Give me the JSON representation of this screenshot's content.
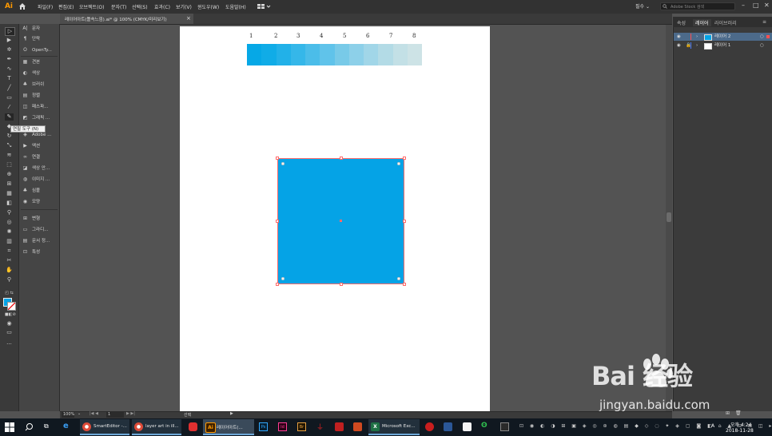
{
  "app": {
    "logo": "Ai"
  },
  "menu": {
    "items": [
      "파일(F)",
      "편집(E)",
      "오브젝트(O)",
      "문자(T)",
      "선택(S)",
      "효과(C)",
      "보기(V)",
      "윈도우(W)",
      "도움말(H)"
    ],
    "workspace": "필수 ⌄",
    "stock_search_placeholder": "Adobe Stock 검색"
  },
  "document": {
    "tab_title": "레이어아트(틀속느낌).ai* @ 100% (CMYK/미리보기)"
  },
  "panel_strip": {
    "items": [
      "문자",
      "단락",
      "OpenTy...",
      "견본",
      "색상",
      "브러쉬",
      "정렬",
      "패스파...",
      "그래픽 ...",
      "Adobe ...",
      "액션",
      "연결",
      "색상 안...",
      "이미지 ...",
      "심볼",
      "모양",
      "변형",
      "그라디...",
      "문서 정...",
      "특성"
    ]
  },
  "tooltip": {
    "text": "연필 도구 (N)"
  },
  "artboard": {
    "swatch_numbers": [
      "1",
      "2",
      "3",
      "4",
      "5",
      "6",
      "7",
      "8"
    ],
    "swatch_colors": [
      "#06a8e6",
      "#10ace7",
      "#22b1e8",
      "#35b7e9",
      "#4bbde9",
      "#60c3ea",
      "#78cae8",
      "#8dd0e9",
      "#a1d6e8",
      "#b3dbe6",
      "#c3e0e6",
      "#cde3e6"
    ],
    "square_color": "#05a3e6"
  },
  "layers_panel": {
    "tabs": [
      "속성",
      "레이어",
      "라이브러리"
    ],
    "layers": [
      {
        "name": "레이어 2",
        "color": "#ff5050",
        "selected": true
      },
      {
        "name": "레이어 1",
        "color": "#4a7cff",
        "selected": false
      }
    ]
  },
  "status": {
    "zoom": "100%",
    "artboard_num": "1",
    "mode": "선택"
  },
  "taskbar": {
    "apps": [
      {
        "label": "SmartEditor -...",
        "icon": "chrome-icon",
        "color": "#dd4b39"
      },
      {
        "label": "layer art in ill...",
        "icon": "chrome-icon",
        "color": "#dd4b39"
      },
      {
        "label": "레이어아트(...",
        "icon": "illustrator-icon",
        "color": "#ff9a00"
      },
      {
        "label": "Microsoft Exc...",
        "icon": "excel-icon",
        "color": "#1e7145"
      }
    ],
    "clock_time": "오후 4:24",
    "clock_date": "2018-11-28"
  },
  "watermark": {
    "baidu": "Bai  经验",
    "site": "jingyan.baidu.com"
  }
}
